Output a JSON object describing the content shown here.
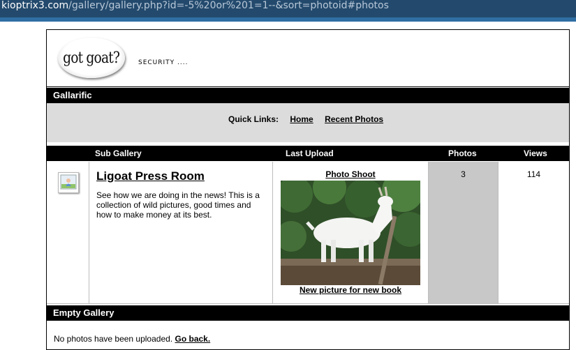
{
  "browser": {
    "url_host": "kioptrix3.com",
    "url_path": "/gallery/gallery.php?id=-5%20or%201=1--&sort=photoid#photos"
  },
  "header": {
    "logo_text": "got goat?",
    "tagline": "SECURITY ...."
  },
  "gallery_title": "Gallarific",
  "quick_links": {
    "label": "Quick Links:",
    "items": [
      "Home",
      "Recent Photos"
    ]
  },
  "table": {
    "columns": [
      "Sub Gallery",
      "Last Upload",
      "Photos",
      "Views"
    ],
    "rows": [
      {
        "name": "Ligoat Press Room",
        "description": "See how we are doing in the news! This is a collection of wild pictures, good times and how to make money at its best.",
        "last_upload_title": "Photo Shoot",
        "last_upload_caption": "New picture for new book",
        "photos": "3",
        "views": "114"
      }
    ]
  },
  "empty_section": {
    "title": "Empty Gallery",
    "message": "No photos have been uploaded.",
    "back_link": "Go back."
  },
  "colors": {
    "url_bar": "#234a6d",
    "header_bar": "#000000",
    "quick_links_bg": "#dcdcdc",
    "photos_column_bg": "#c8c8c8"
  }
}
